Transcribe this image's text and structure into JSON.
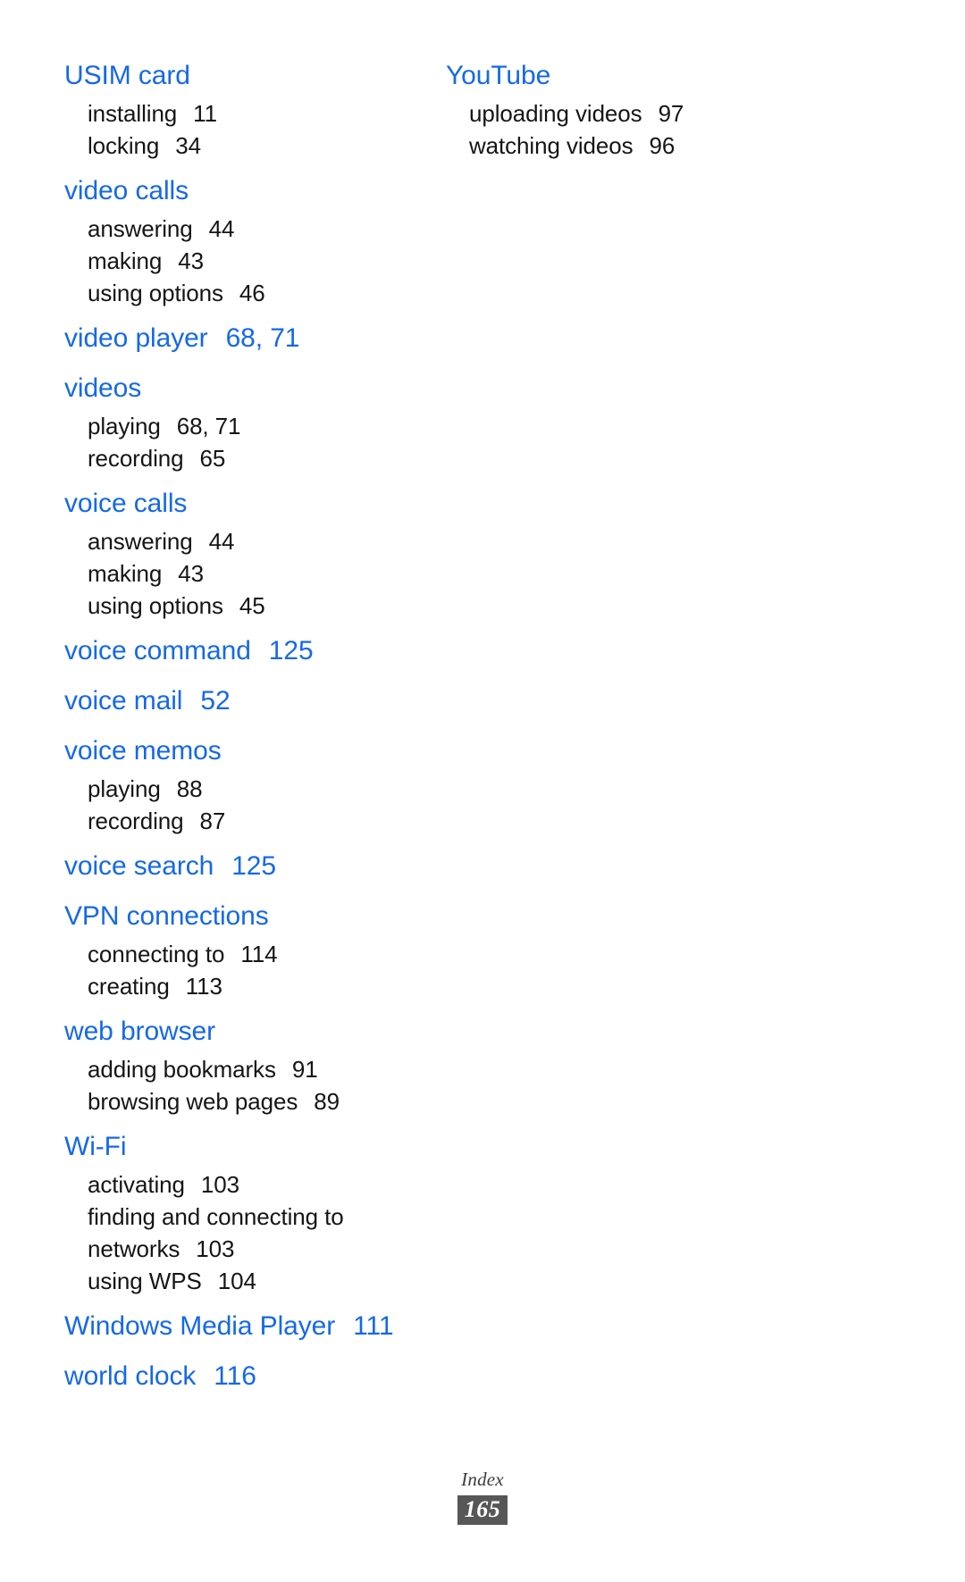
{
  "colors": {
    "heading_blue": "#1569e8",
    "body_text": "#151515",
    "badge_background": "#575757",
    "badge_text": "#ffffff",
    "page_background": "#ffffff"
  },
  "footer": {
    "label": "Index",
    "page_number": "165"
  },
  "columns": [
    {
      "id": "left",
      "groups": [
        {
          "heading": "USIM card",
          "heading_pages": "",
          "subentries": [
            {
              "label": "installing",
              "pages": "11"
            },
            {
              "label": "locking",
              "pages": "34"
            }
          ]
        },
        {
          "heading": "video calls",
          "heading_pages": "",
          "subentries": [
            {
              "label": "answering",
              "pages": "44"
            },
            {
              "label": "making",
              "pages": "43"
            },
            {
              "label": "using options",
              "pages": "46"
            }
          ]
        },
        {
          "heading": "video player",
          "heading_pages": "68, 71",
          "subentries": []
        },
        {
          "heading": "videos",
          "heading_pages": "",
          "subentries": [
            {
              "label": "playing",
              "pages": "68, 71"
            },
            {
              "label": "recording",
              "pages": "65"
            }
          ]
        },
        {
          "heading": "voice calls",
          "heading_pages": "",
          "subentries": [
            {
              "label": "answering",
              "pages": "44"
            },
            {
              "label": "making",
              "pages": "43"
            },
            {
              "label": "using options",
              "pages": "45"
            }
          ]
        },
        {
          "heading": "voice command",
          "heading_pages": "125",
          "subentries": []
        },
        {
          "heading": "voice mail",
          "heading_pages": "52",
          "subentries": []
        },
        {
          "heading": "voice memos",
          "heading_pages": "",
          "subentries": [
            {
              "label": "playing",
              "pages": "88"
            },
            {
              "label": "recording",
              "pages": "87"
            }
          ]
        },
        {
          "heading": "voice search",
          "heading_pages": "125",
          "subentries": []
        },
        {
          "heading": "VPN connections",
          "heading_pages": "",
          "subentries": [
            {
              "label": "connecting to",
              "pages": "114"
            },
            {
              "label": "creating",
              "pages": "113"
            }
          ]
        },
        {
          "heading": "web browser",
          "heading_pages": "",
          "subentries": [
            {
              "label": "adding bookmarks",
              "pages": "91"
            },
            {
              "label": "browsing web pages",
              "pages": "89"
            }
          ]
        },
        {
          "heading": "Wi-Fi",
          "heading_pages": "",
          "subentries": [
            {
              "label": "activating",
              "pages": "103"
            },
            {
              "label": "finding and connecting to networks",
              "pages": "103"
            },
            {
              "label": "using WPS",
              "pages": "104"
            }
          ]
        },
        {
          "heading": "Windows Media Player",
          "heading_pages": "111",
          "subentries": []
        },
        {
          "heading": "world clock",
          "heading_pages": "116",
          "subentries": []
        }
      ]
    },
    {
      "id": "right",
      "groups": [
        {
          "heading": "YouTube",
          "heading_pages": "",
          "subentries": [
            {
              "label": "uploading videos",
              "pages": "97"
            },
            {
              "label": "watching videos",
              "pages": "96"
            }
          ]
        }
      ]
    }
  ]
}
